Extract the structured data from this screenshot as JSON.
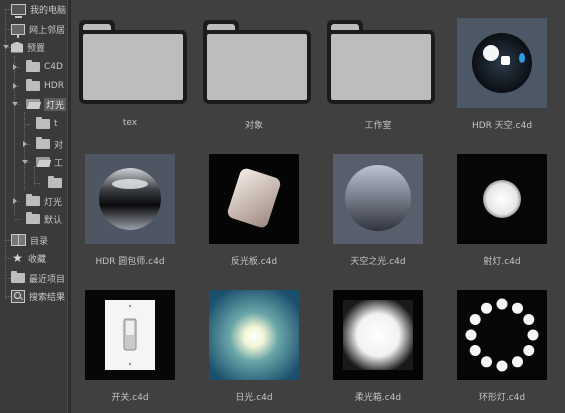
{
  "sidebar": {
    "items": [
      {
        "label": "我的电脑",
        "icon": "monitor-icon"
      },
      {
        "label": "网上邻居",
        "icon": "network-drive-icon"
      },
      {
        "label": "预置",
        "icon": "box-icon"
      },
      {
        "label": "C4D",
        "icon": "folder-icon"
      },
      {
        "label": "HDR",
        "icon": "folder-icon"
      },
      {
        "label": "灯光",
        "icon": "folder-open-icon"
      },
      {
        "label": "t",
        "icon": "folder-icon"
      },
      {
        "label": "对",
        "icon": "folder-icon"
      },
      {
        "label": "工",
        "icon": "folder-open-icon"
      },
      {
        "label": "",
        "icon": "folder-icon"
      },
      {
        "label": "灯光",
        "icon": "folder-icon"
      },
      {
        "label": "默认",
        "icon": "folder-icon"
      },
      {
        "label": "目录",
        "icon": "book-icon"
      },
      {
        "label": "收藏",
        "icon": "star-icon"
      },
      {
        "label": "最近项目",
        "icon": "folder-icon"
      },
      {
        "label": "搜索结果",
        "icon": "search-icon"
      }
    ]
  },
  "grid": {
    "items": [
      {
        "label": "tex",
        "kind": "folder"
      },
      {
        "label": "对象",
        "kind": "folder"
      },
      {
        "label": "工作室",
        "kind": "folder"
      },
      {
        "label": "HDR 天空.c4d",
        "kind": "hdr-sky"
      },
      {
        "label": "HDR 圆包师.c4d",
        "kind": "hdr-sphere"
      },
      {
        "label": "反光板.c4d",
        "kind": "reflector"
      },
      {
        "label": "天空之光.c4d",
        "kind": "sky-light"
      },
      {
        "label": "射灯.c4d",
        "kind": "spotlight"
      },
      {
        "label": "开关.c4d",
        "kind": "switch"
      },
      {
        "label": "日光.c4d",
        "kind": "sunlight"
      },
      {
        "label": "柔光箱.c4d",
        "kind": "softbox"
      },
      {
        "label": "环形灯.c4d",
        "kind": "ring-light"
      }
    ]
  }
}
